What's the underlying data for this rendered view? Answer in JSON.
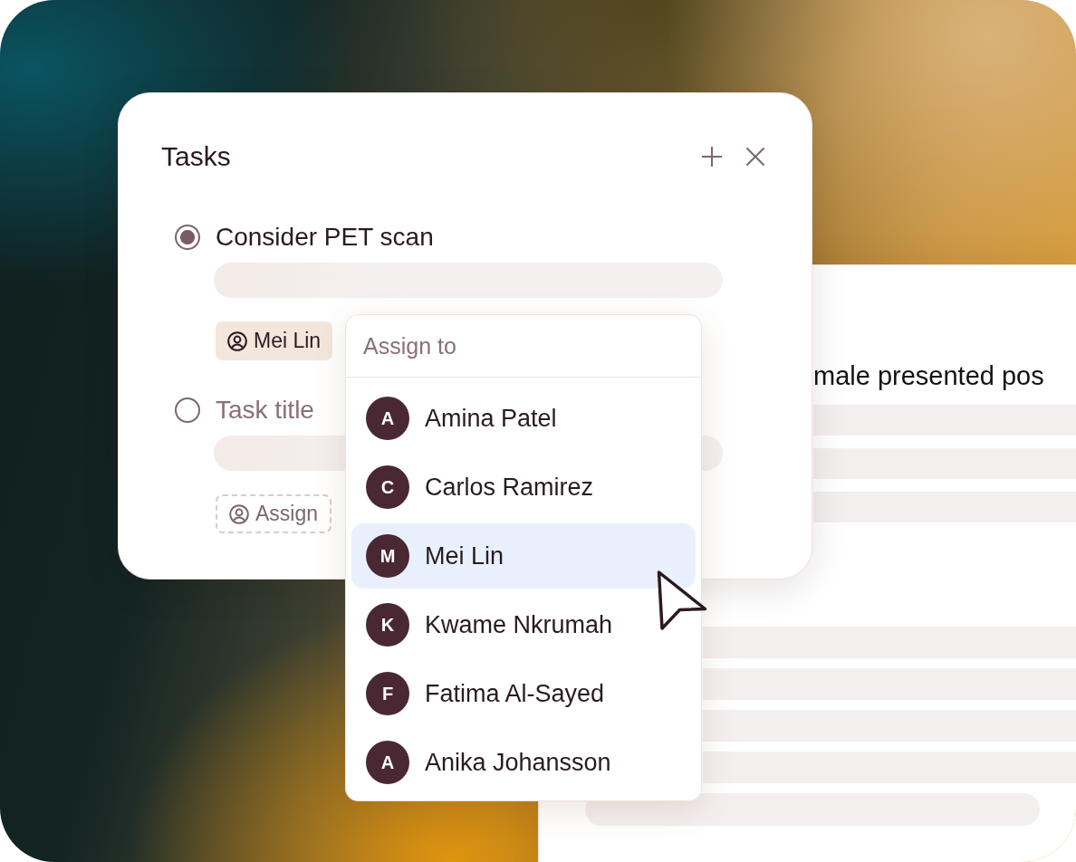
{
  "tasks_panel": {
    "title": "Tasks",
    "tasks": [
      {
        "title": "Consider PET scan",
        "selected": true,
        "assignee": {
          "kind": "assigned",
          "label": "Mei Lin"
        }
      },
      {
        "placeholder": "Task title",
        "selected": false,
        "assignee": {
          "kind": "unassigned",
          "label": "Assign"
        }
      }
    ]
  },
  "assign_menu": {
    "search": {
      "placeholder": "Assign to"
    },
    "people": [
      {
        "initial": "A",
        "name": "Amina Patel",
        "selected": false
      },
      {
        "initial": "C",
        "name": "Carlos Ramirez",
        "selected": false
      },
      {
        "initial": "M",
        "name": "Mei Lin",
        "selected": true
      },
      {
        "initial": "K",
        "name": "Kwame Nkrumah",
        "selected": false
      },
      {
        "initial": "F",
        "name": "Fatima Al-Sayed",
        "selected": false
      },
      {
        "initial": "A",
        "name": "Anika Johansson",
        "selected": false
      }
    ]
  },
  "document": {
    "visible_text": "male presented pos"
  }
}
